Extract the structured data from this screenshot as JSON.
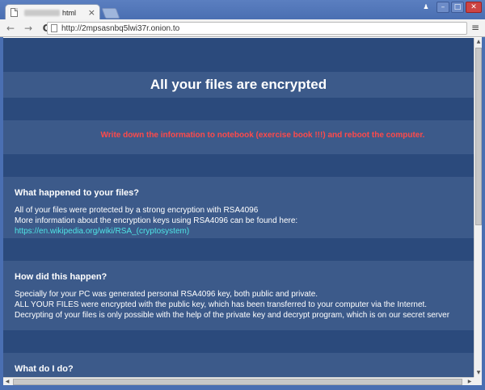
{
  "browser": {
    "tab_suffix": "html",
    "tab_close": "×",
    "url": "http://2mpsasnbq5lwi37r.onion.to",
    "back_icon": "←",
    "forward_icon": "→",
    "reload_icon": "C",
    "menu_icon": "≡",
    "window": {
      "minimize": "–",
      "maximize": "□",
      "close": "✕",
      "user": "♟"
    }
  },
  "page": {
    "headline": "All your files are encrypted",
    "warning": "Write down the information to notebook (exercise book !!!) and reboot the computer.",
    "sections": [
      {
        "title": "What happened to your files?",
        "line1": "All of your files were protected by a strong encryption with RSA4096",
        "line2_text": "More information about the encryption keys using RSA4096 can be found here: ",
        "line2_link": "https://en.wikipedia.org/wiki/RSA_(cryptosystem)"
      },
      {
        "title": "How did this happen?",
        "line1": "Specially for your PC was generated personal RSA4096 key, both public and private.",
        "line2": "ALL YOUR FILES were encrypted with the public key, which has been transferred to your computer via the Internet.",
        "line3": "Decrypting of your files is only possible with the help of the private key and decrypt program, which is on our secret server"
      },
      {
        "title": "What do I do?"
      }
    ]
  },
  "colors": {
    "band_dark": "#2b4a7c",
    "band_light": "#3c5a8a",
    "warning": "#ff4a4a",
    "link": "#4fe6e6"
  }
}
